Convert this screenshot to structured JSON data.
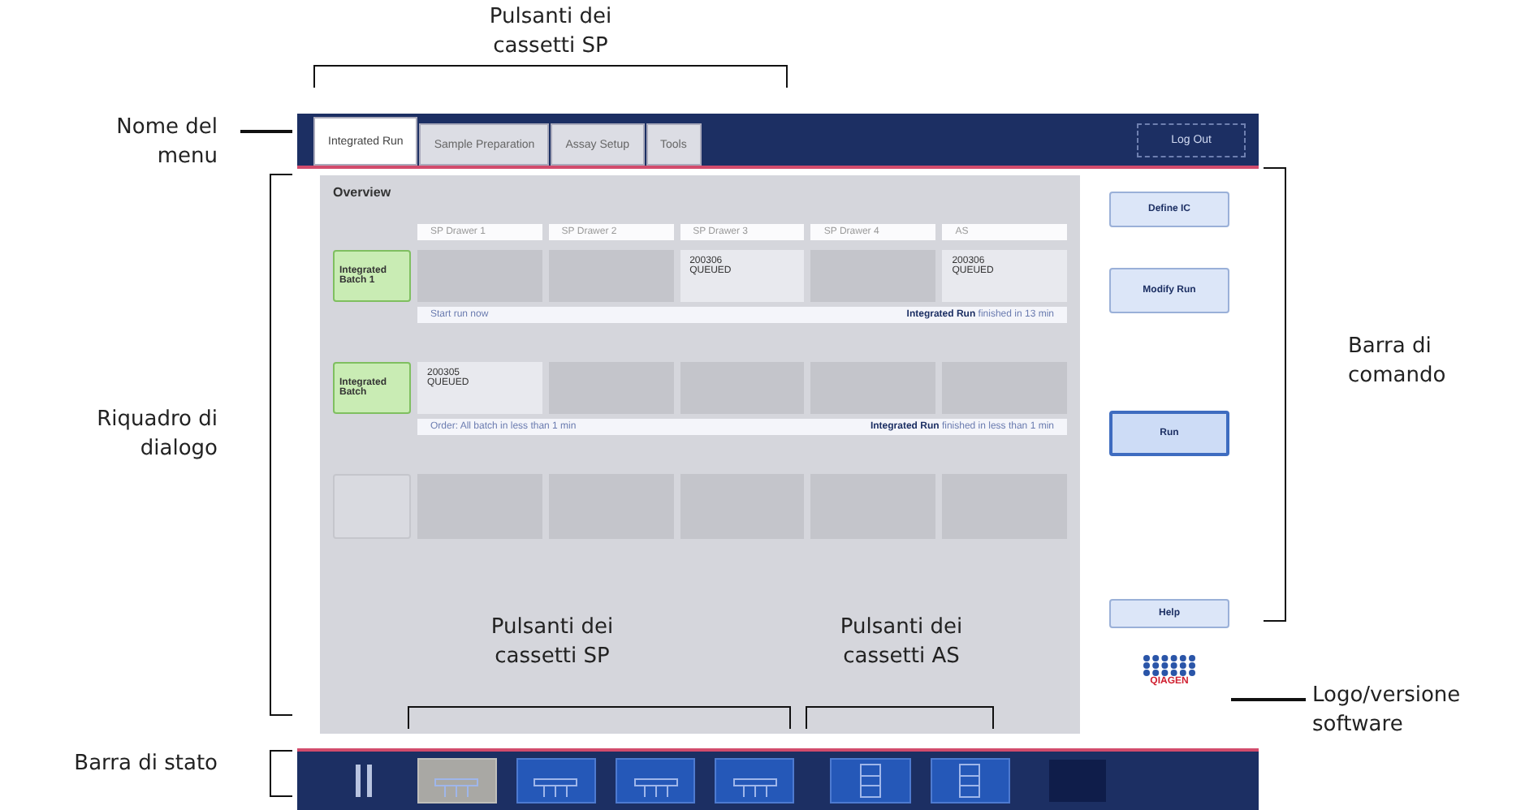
{
  "callouts": {
    "top_sp": "Pulsanti dei cassetti SP",
    "menu_name": "Nome del menu",
    "dialog": "Riquadro di dialogo",
    "status": "Barra di stato",
    "command": "Barra di comando",
    "logo": "Logo/versione software",
    "bottom_sp": "Pulsanti dei cassetti SP",
    "bottom_as": "Pulsanti dei cassetti AS"
  },
  "tabs": [
    {
      "label": "Integrated Run",
      "selected": true
    },
    {
      "label": "Sample Preparation",
      "selected": false
    },
    {
      "label": "Assay Setup",
      "selected": false
    },
    {
      "label": "Tools",
      "selected": false
    }
  ],
  "logout": "Log Out",
  "dialog": {
    "title": "Overview",
    "columns": [
      "SP Drawer 1",
      "SP Drawer 2",
      "SP Drawer 3",
      "SP Drawer 4",
      "AS"
    ],
    "batches": [
      {
        "label": "Integrated Batch 1",
        "cells": [
          "",
          "",
          "200306\nQUEUED",
          "",
          "200306\nQUEUED"
        ],
        "info_left": "Start run now",
        "info_right": "**Integrated Run** finished in 13 min"
      },
      {
        "label": "Integrated Batch",
        "cells": [
          "200305\nQUEUED",
          "",
          "",
          "",
          ""
        ],
        "info_left": "Order: All batch in less than 1 min",
        "info_right": "**Integrated Run** finished in less than 1 min"
      },
      {
        "cells": [
          "",
          "",
          "",
          "",
          ""
        ]
      }
    ]
  },
  "commands": [
    {
      "label": "Define IC",
      "selected": false
    },
    {
      "label": "Modify Run",
      "selected": false
    },
    {
      "label": "Run",
      "selected": true
    },
    {
      "label": "Help",
      "selected": false
    }
  ],
  "logo_text": "QIAGEN",
  "status_bar": [
    {
      "kind": "sp",
      "selected": true
    },
    {
      "kind": "sp",
      "selected": false
    },
    {
      "kind": "sp",
      "selected": false
    },
    {
      "kind": "sp",
      "selected": false
    },
    {
      "kind": "as",
      "selected": false
    },
    {
      "kind": "as",
      "selected": false
    }
  ]
}
